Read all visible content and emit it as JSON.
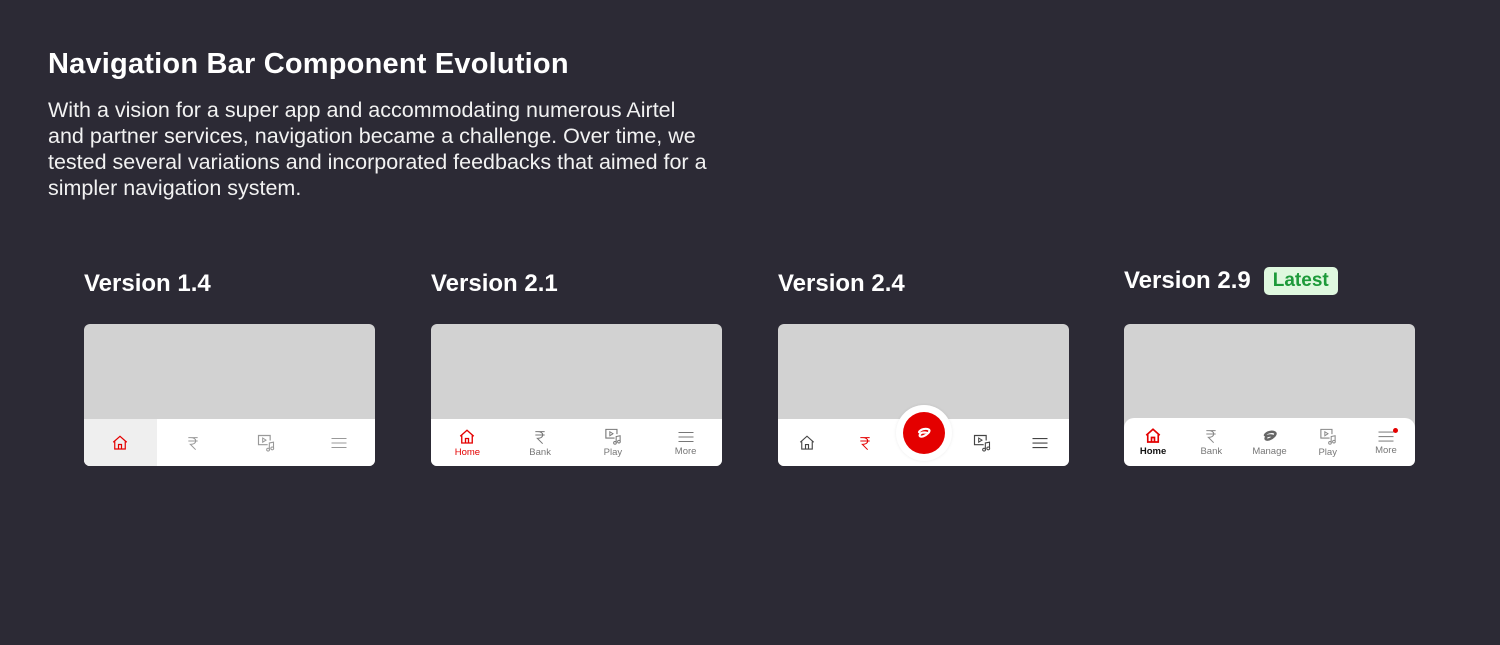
{
  "header": {
    "title": "Navigation Bar Component Evolution",
    "description": "With a vision for a super app and accommodating numerous Airtel and partner services, navigation became a challenge. Over time, we tested several variations and incorporated feedbacks that aimed for a simpler navigation system."
  },
  "colors": {
    "accent": "#e40000",
    "background": "#2c2a35",
    "badge_bg": "#dff8df",
    "badge_text": "#1d9a3a"
  },
  "versions": [
    {
      "title": "Version 1.4",
      "items": [
        {
          "icon": "home-icon",
          "active": true
        },
        {
          "icon": "rupee-icon"
        },
        {
          "icon": "play-music-icon"
        },
        {
          "icon": "menu-icon"
        }
      ]
    },
    {
      "title": "Version 2.1",
      "items": [
        {
          "icon": "home-icon",
          "label": "Home",
          "active": true
        },
        {
          "icon": "rupee-icon",
          "label": "Bank"
        },
        {
          "icon": "play-music-icon",
          "label": "Play"
        },
        {
          "icon": "menu-icon",
          "label": "More"
        }
      ]
    },
    {
      "title": "Version 2.4",
      "items": [
        {
          "icon": "home-icon"
        },
        {
          "icon": "rupee-icon",
          "active": true
        },
        {
          "icon": "airtel-logo-icon",
          "center": true
        },
        {
          "icon": "play-music-icon"
        },
        {
          "icon": "menu-icon"
        }
      ]
    },
    {
      "title": "Version 2.9",
      "badge": "Latest",
      "items": [
        {
          "icon": "home-icon",
          "label": "Home",
          "active": true
        },
        {
          "icon": "rupee-icon",
          "label": "Bank"
        },
        {
          "icon": "airtel-logo-icon",
          "label": "Manage"
        },
        {
          "icon": "play-music-icon",
          "label": "Play"
        },
        {
          "icon": "menu-icon",
          "label": "More",
          "notification": true
        }
      ]
    }
  ]
}
